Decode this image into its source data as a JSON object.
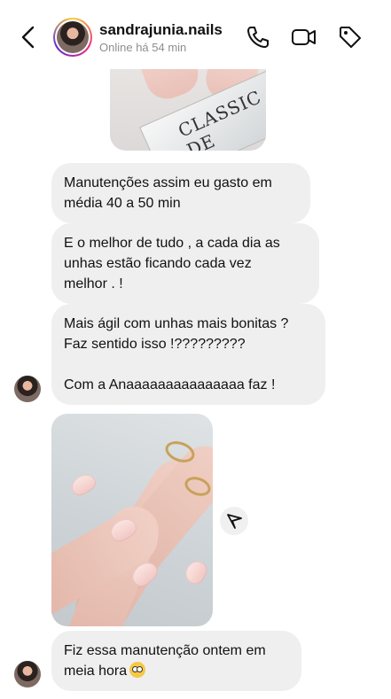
{
  "header": {
    "username": "sandrajunia.nails",
    "status": "Online há 54 min",
    "icons": [
      "back-icon",
      "phone-icon",
      "video-icon",
      "tag-icon"
    ]
  },
  "messages": [
    {
      "text": "Manutenções assim eu gasto em\nmédia 40 a 50 min"
    },
    {
      "text": "E o melhor de tudo , a cada dia as\nunhas estão ficando cada vez\nmelhor . !"
    },
    {
      "text": "Mais ágil com unhas mais bonitas ?\nFaz sentido isso !?????????\n\nCom a Anaaaaaaaaaaaaaaa faz !"
    },
    {
      "text": "Fiz essa manutenção ontem em\nmeia hora"
    }
  ],
  "images": {
    "top_card_text": "CLASSIC DE"
  },
  "colors": {
    "bubble": "#efefef",
    "secondary_text": "#8e8e8e"
  }
}
